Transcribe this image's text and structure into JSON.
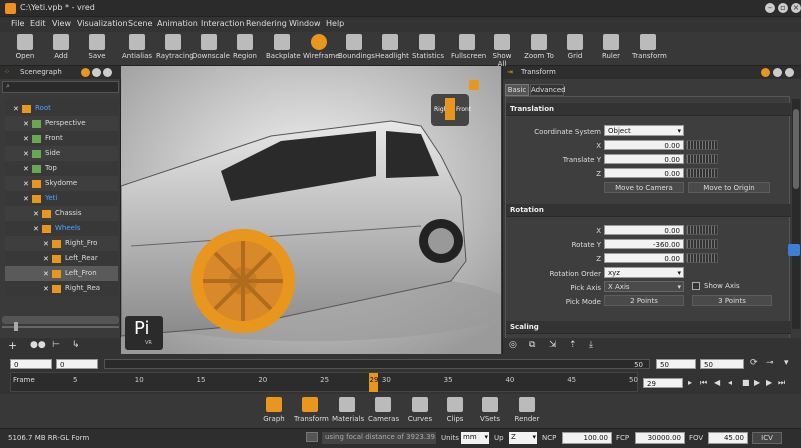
{
  "window": {
    "title": "C:\\Yeti.vpb * - vred"
  },
  "menu": [
    "File",
    "Edit",
    "View",
    "Visualization",
    "Scene",
    "Animation",
    "Interaction",
    "Rendering",
    "Window",
    "Help"
  ],
  "toolbar": [
    "Open",
    "Add",
    "Save",
    "Antialias",
    "Raytracing",
    "Downscale",
    "Region",
    "Backplate",
    "Wireframe",
    "Boundings",
    "Headlight",
    "Statistics",
    "Fullscreen",
    "Show All",
    "Zoom To",
    "Grid",
    "Ruler",
    "Transform"
  ],
  "scenegraph": {
    "title": "Scenegraph",
    "rows": [
      {
        "name": "Root",
        "color": "#4da3ff"
      },
      {
        "name": "Perspective",
        "color": "#ddd"
      },
      {
        "name": "Front",
        "color": "#ddd"
      },
      {
        "name": "Side",
        "color": "#ddd"
      },
      {
        "name": "Top",
        "color": "#ddd"
      },
      {
        "name": "Skydome",
        "color": "#ddd"
      },
      {
        "name": "Yeti",
        "color": "#4da3ff"
      },
      {
        "name": "Chassis",
        "color": "#ddd"
      },
      {
        "name": "Wheels",
        "color": "#4da3ff"
      },
      {
        "name": "Right_Fro",
        "color": "#ddd"
      },
      {
        "name": "Left_Rear",
        "color": "#ddd"
      },
      {
        "name": "Left_Fron",
        "color": "#ddd"
      },
      {
        "name": "Right_Rea",
        "color": "#ddd"
      }
    ]
  },
  "viewport": {
    "cube_left": "Righ",
    "cube_right": "Front",
    "logo": "Pi",
    "logo_sub": "VR"
  },
  "transform": {
    "title": "Transform",
    "tabs": [
      "Basic",
      "Advanced"
    ],
    "translation": {
      "header": "Translation",
      "coord_label": "Coordinate System",
      "coord_value": "Object",
      "x_label": "X",
      "x": "0.00",
      "y_label": "Translate Y",
      "y": "0.00",
      "z_label": "Z",
      "z": "0.00",
      "move_camera": "Move to Camera",
      "move_origin": "Move to Origin"
    },
    "rotation": {
      "header": "Rotation",
      "x_label": "X",
      "x": "0.00",
      "y_label": "Rotate Y",
      "y": "-360.00",
      "z_label": "Z",
      "z": "0.00",
      "order_label": "Rotation Order",
      "order": "xyz",
      "pick_axis_label": "Pick Axis",
      "pick_axis": "X Axis",
      "show_axis": "Show Axis",
      "pick_mode_label": "Pick Mode",
      "two_points": "2 Points",
      "three_points": "3 Points"
    },
    "scaling": {
      "header": "Scaling"
    }
  },
  "timeline": {
    "start1": "0",
    "start2": "0",
    "end_a": "50",
    "end_b": "50",
    "end_c": "50",
    "current": "29",
    "frame_label": "Frame",
    "ticks": [
      "5",
      "10",
      "15",
      "20",
      "25",
      "29",
      "30",
      "35",
      "40",
      "45",
      "50"
    ]
  },
  "dock": [
    "Graph",
    "Transform",
    "Materials",
    "Cameras",
    "Curves",
    "Clips",
    "VSets",
    "Render"
  ],
  "status": {
    "memory": "5106.7 MB RR-GL Form",
    "message": "using focal distance of 3923.39...",
    "units_label": "Units",
    "units": "mm",
    "up_label": "Up",
    "up": "Z",
    "ncp_label": "NCP",
    "ncp": "100.00",
    "fcp_label": "FCP",
    "fcp": "30000.00",
    "fov_label": "FOV",
    "fov": "45.00",
    "icv": "ICV"
  }
}
